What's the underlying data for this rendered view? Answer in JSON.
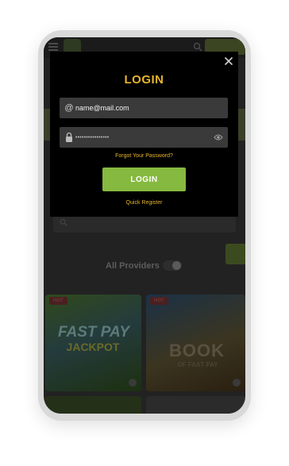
{
  "modal": {
    "title": "LOGIN",
    "email": {
      "value": "name@mail.com",
      "icon": "at-icon"
    },
    "password": {
      "value": "••••••••••••••••",
      "icon": "lock-icon",
      "toggle_icon": "eye-icon"
    },
    "forgot_password": "Forgot Your Password?",
    "login_button": "LOGIN",
    "quick_register": "Quick Register",
    "close_icon": "close-icon"
  },
  "background": {
    "providers_label": "All Providers",
    "games": [
      {
        "badge": "HOT",
        "title": "FAST PAY",
        "subtitle": "JACKPOT"
      },
      {
        "badge": "HOT",
        "title": "BOOK",
        "subtitle": "OF FAST PAY"
      }
    ]
  },
  "colors": {
    "accent_gold": "#e7b52b",
    "login_green": "#86b93f",
    "modal_bg": "#000000",
    "field_bg": "#3a3a3a"
  }
}
